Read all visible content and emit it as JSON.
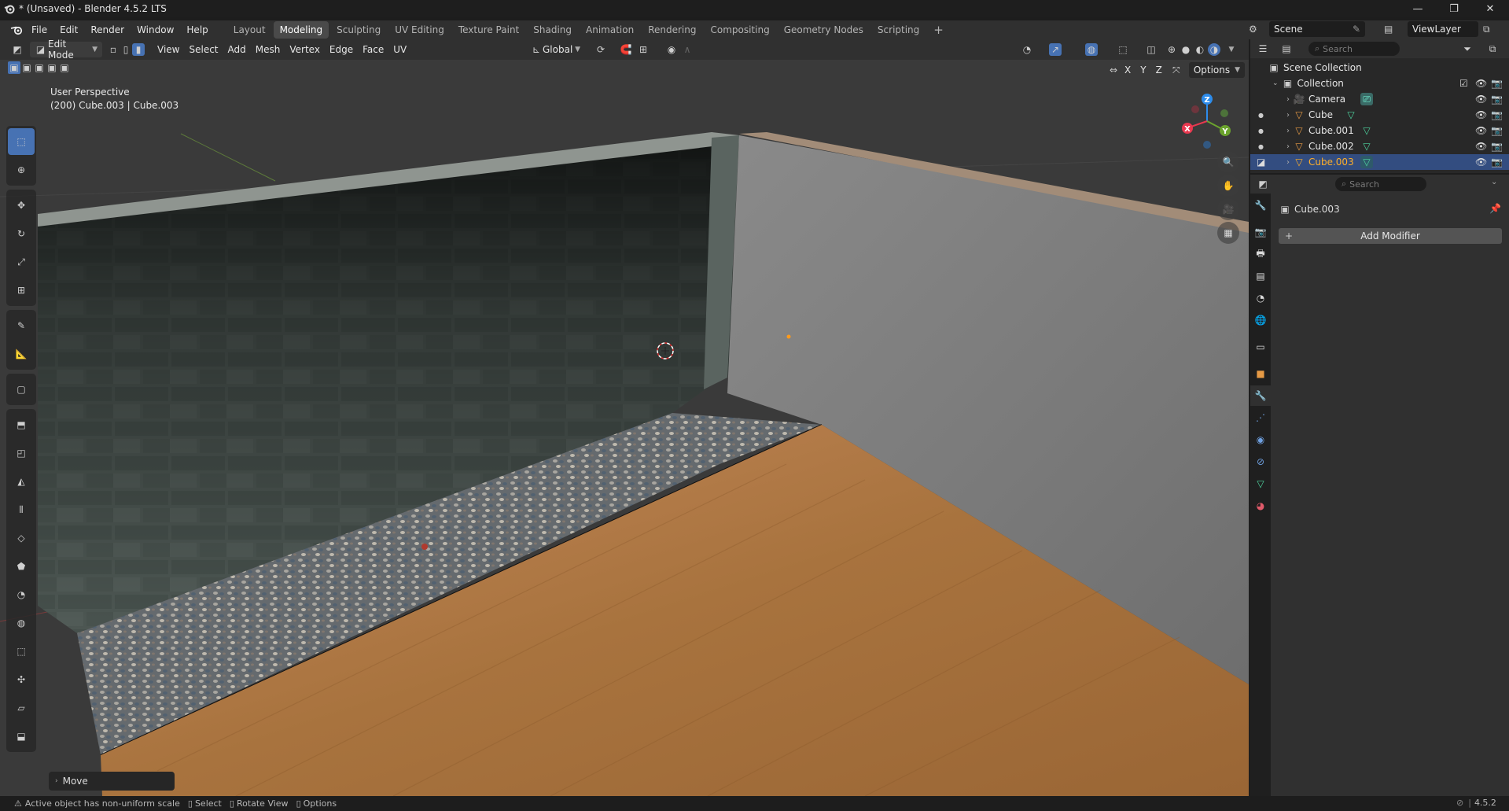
{
  "window": {
    "title": "* (Unsaved) - Blender 4.5.2 LTS",
    "controls": {
      "minimize": "—",
      "maximize": "❐",
      "close": "✕"
    }
  },
  "menu": [
    "File",
    "Edit",
    "Render",
    "Window",
    "Help"
  ],
  "workspaces": [
    "Layout",
    "Modeling",
    "Sculpting",
    "UV Editing",
    "Texture Paint",
    "Shading",
    "Animation",
    "Rendering",
    "Compositing",
    "Geometry Nodes",
    "Scripting"
  ],
  "active_workspace": "Modeling",
  "scene": {
    "scene_name": "Scene",
    "view_layer": "ViewLayer"
  },
  "viewport": {
    "mode": "Edit Mode",
    "header_menus": [
      "View",
      "Select",
      "Add",
      "Mesh",
      "Vertex",
      "Edge",
      "Face",
      "UV"
    ],
    "transform_orientation": "Global",
    "options_label": "Options",
    "axes": [
      "X",
      "Y",
      "Z"
    ],
    "perspective_label": "User Perspective",
    "object_label": "(200) Cube.003 | Cube.003",
    "gizmo": {
      "x": "X",
      "y": "Y",
      "z": "Z"
    },
    "operator_panel": "Move"
  },
  "outliner": {
    "search_placeholder": "Search",
    "root": "Scene Collection",
    "collection": "Collection",
    "items": [
      {
        "label": "Camera",
        "selected": false
      },
      {
        "label": "Cube",
        "selected": false
      },
      {
        "label": "Cube.001",
        "selected": false
      },
      {
        "label": "Cube.002",
        "selected": false
      },
      {
        "label": "Cube.003",
        "selected": true
      }
    ]
  },
  "properties": {
    "search_placeholder": "Search",
    "object_name": "Cube.003",
    "add_modifier": "Add Modifier"
  },
  "statusbar": {
    "warning": "Active object has non-uniform scale",
    "select": "Select",
    "rotate": "Rotate View",
    "options": "Options",
    "version": "4.5.2"
  },
  "colors": {
    "accent": "#4772b3",
    "selected_text": "#ffaf29",
    "wall_base": "#4a5450",
    "floor_wood": "#a8733e",
    "gizmo_x": "#e8384f",
    "gizmo_y": "#6ba32d",
    "gizmo_z": "#2d8ceb"
  }
}
